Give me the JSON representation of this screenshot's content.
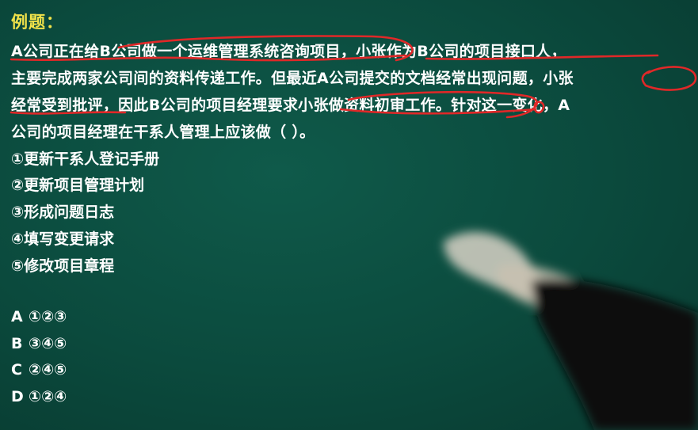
{
  "title": "例题：",
  "question_lines": [
    "A公司正在给B公司做一个运维管理系统咨询项目，小张作为B公司的项目接口人，",
    "主要完成两家公司间的资料传递工作。但最近A公司提交的文档经常出现问题，小张",
    "经常受到批评，因此B公司的项目经理要求小张做资料初审工作。针对这一变化，A",
    "公司的项目经理在干系人管理上应该做（ ）。"
  ],
  "items": [
    "①更新干系人登记手册",
    "②更新项目管理计划",
    "③形成问题日志",
    "④填写变更请求",
    "⑤修改项目章程"
  ],
  "options": [
    {
      "letter": "A",
      "value": "①②③"
    },
    {
      "letter": "B",
      "value": "③④⑤"
    },
    {
      "letter": "C",
      "value": "②④⑤"
    },
    {
      "letter": "D",
      "value": "①②④"
    }
  ],
  "colors": {
    "board": "#0b4a3d",
    "title": "#f0e24a",
    "text": "#ffffff",
    "annotation": "#e02828"
  }
}
